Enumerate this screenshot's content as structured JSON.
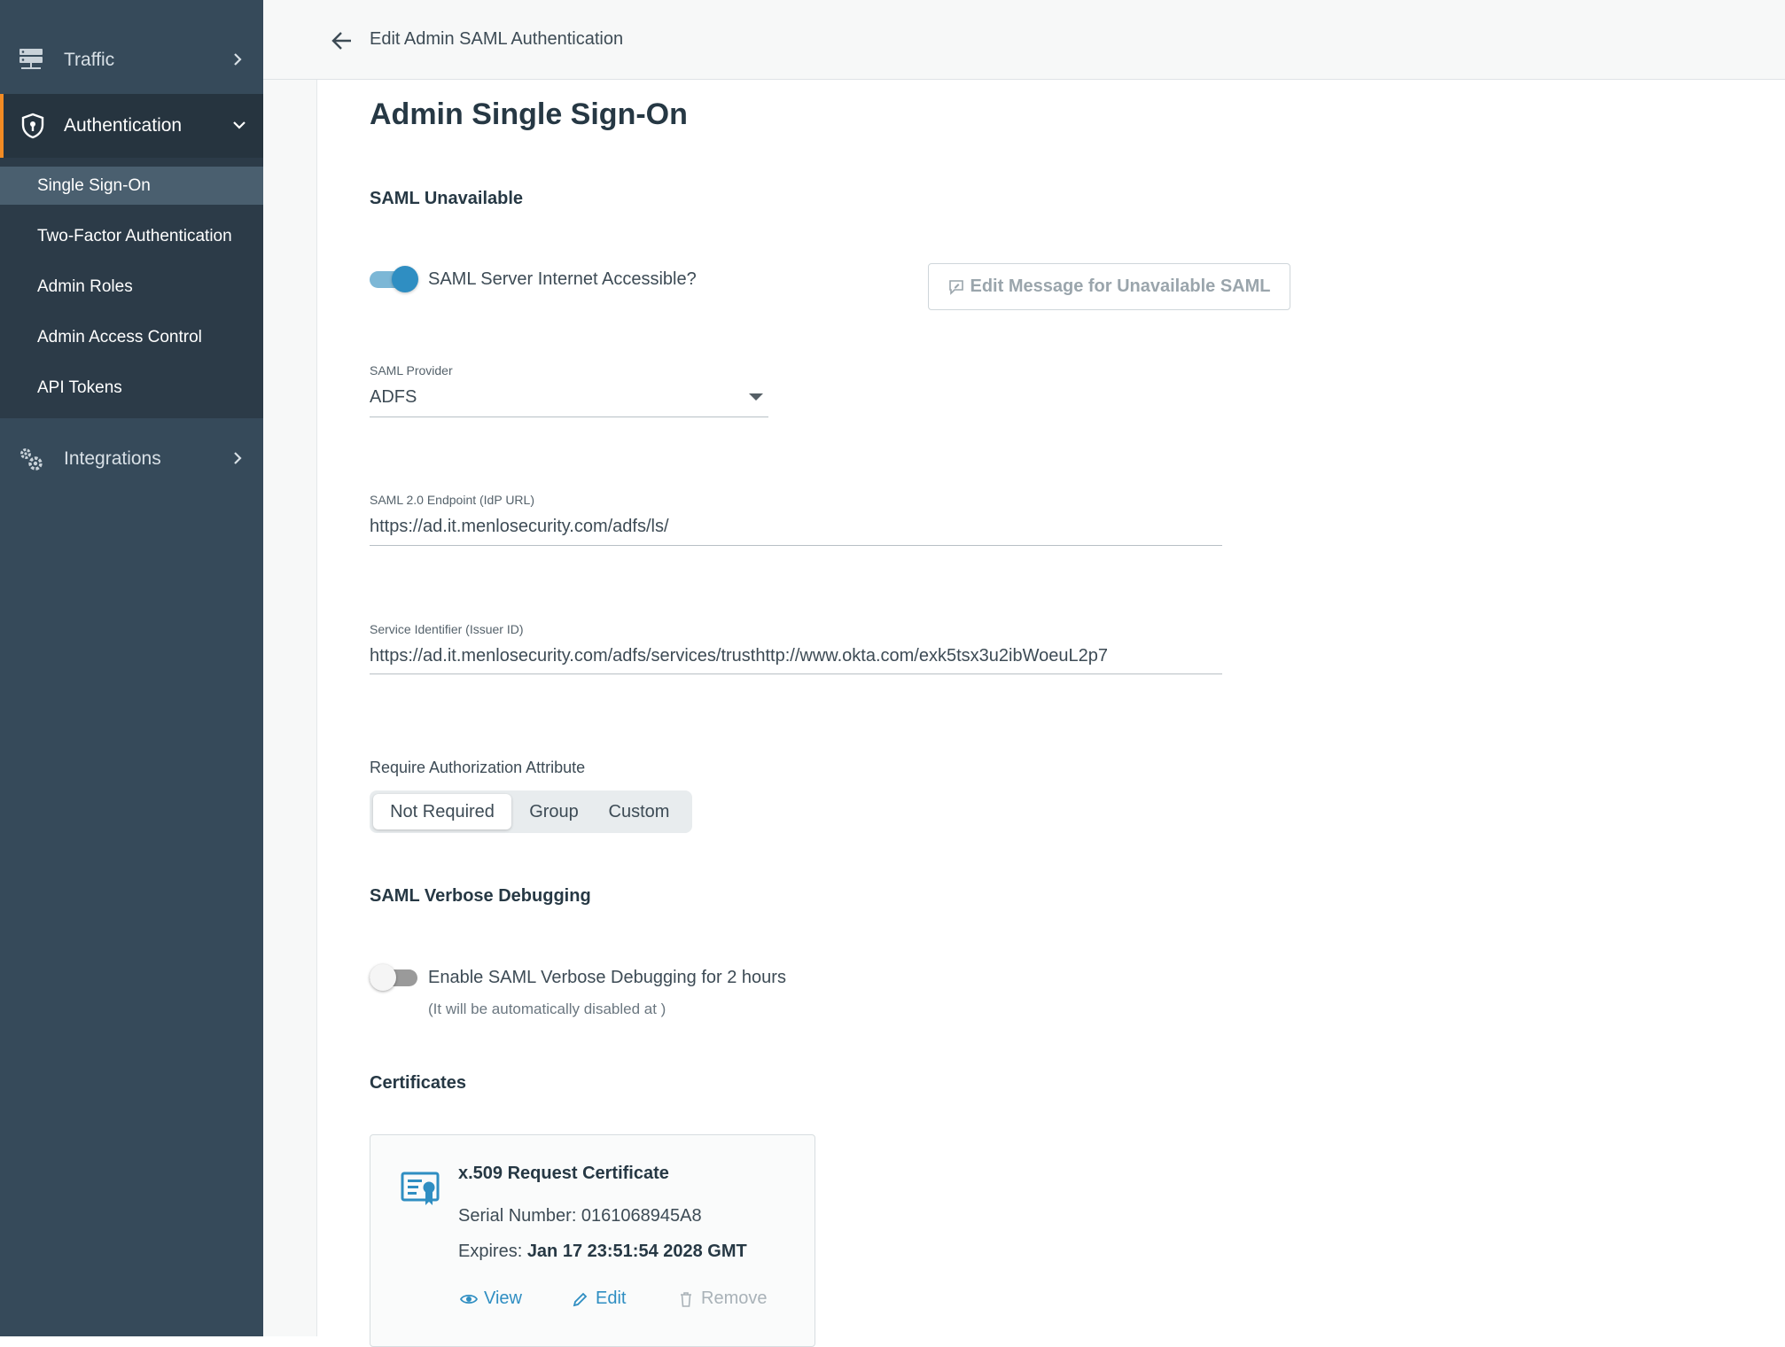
{
  "sidebar": {
    "traffic_label": "Traffic",
    "authentication_label": "Authentication",
    "integrations_label": "Integrations",
    "auth_items": [
      {
        "label": "Single Sign-On"
      },
      {
        "label": "Two-Factor Authentication"
      },
      {
        "label": "Admin Roles"
      },
      {
        "label": "Admin Access Control"
      },
      {
        "label": "API Tokens"
      }
    ]
  },
  "header": {
    "title": "Edit Admin SAML Authentication"
  },
  "main": {
    "page_title": "Admin Single Sign-On",
    "saml_unavailable": {
      "heading": "SAML Unavailable",
      "toggle_label": "SAML Server Internet Accessible?",
      "toggle_on": true,
      "edit_message_button": "Edit Message for Unavailable SAML"
    },
    "saml_provider": {
      "label": "SAML Provider",
      "value": "ADFS"
    },
    "endpoint": {
      "label": "SAML 2.0 Endpoint (IdP URL)",
      "value": "https://ad.it.menlosecurity.com/adfs/ls/"
    },
    "service_identifier": {
      "label": "Service Identifier (Issuer ID)",
      "value": "https://ad.it.menlosecurity.com/adfs/services/trusthttp://www.okta.com/exk5tsx3u2ibWoeuL2p7"
    },
    "authorization": {
      "label": "Require Authorization Attribute",
      "options": [
        "Not Required",
        "Group",
        "Custom"
      ],
      "selected": "Not Required"
    },
    "verbose_debugging": {
      "heading": "SAML Verbose Debugging",
      "toggle_label": "Enable SAML Verbose Debugging for 2 hours",
      "toggle_on": false,
      "hint": "(It will be automatically disabled at )"
    },
    "certificates": {
      "heading": "Certificates",
      "card": {
        "title": "x.509 Request Certificate",
        "serial": "Serial Number: 0161068945A8",
        "expires_label": "Expires: ",
        "expires_value": "Jan 17 23:51:54 2028 GMT",
        "view_label": "View",
        "edit_label": "Edit",
        "remove_label": "Remove"
      }
    }
  },
  "colors": {
    "sidebar_bg": "#364a5a",
    "sidebar_active_bg": "#26343f",
    "accent_orange": "#f28b24",
    "primary_blue": "#2f8ec2"
  },
  "icons": [
    "server-icon",
    "shield-icon",
    "gears-icon",
    "chevron-right-icon",
    "chevron-down-icon",
    "back-arrow-icon",
    "message-edit-icon",
    "certificate-icon",
    "eye-icon",
    "pencil-icon",
    "trash-icon"
  ]
}
